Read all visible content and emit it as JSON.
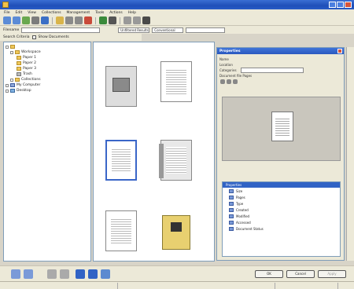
{
  "titlebar": {
    "title": ""
  },
  "menu": [
    "File",
    "Edit",
    "View",
    "Collections",
    "Management",
    "Tools",
    "Actions",
    "Help"
  ],
  "toolbar2": {
    "field_label": "Filename",
    "combo1": "Unfiltered Results",
    "combo2": "Conventional"
  },
  "toolbar3": {
    "search_label": "Search Criteria",
    "checkbox_label": "Show Documents"
  },
  "tree": [
    {
      "label": "",
      "level": 0
    },
    {
      "label": "Workspace",
      "level": 1
    },
    {
      "label": "Paper 1",
      "level": 2
    },
    {
      "label": "Paper 2",
      "level": 2
    },
    {
      "label": "Paper 3",
      "level": 2
    },
    {
      "label": "Trash",
      "level": 2
    },
    {
      "label": "Collections",
      "level": 1
    },
    {
      "label": "My Computer",
      "level": 0
    },
    {
      "label": "Desktop",
      "level": 0
    }
  ],
  "thumbnails": [
    {
      "caption": "",
      "selected": false,
      "kind": "photo"
    },
    {
      "caption": "",
      "selected": false,
      "kind": "doc"
    },
    {
      "caption": "",
      "selected": true,
      "kind": "doc"
    },
    {
      "caption": "",
      "selected": false,
      "kind": "stack"
    },
    {
      "caption": "",
      "selected": false,
      "kind": "doc"
    },
    {
      "caption": "",
      "selected": false,
      "kind": "book"
    }
  ],
  "properties": {
    "title": "Properties",
    "rows": [
      {
        "label": "Name",
        "value": ""
      },
      {
        "label": "Location",
        "value": ""
      },
      {
        "label": "Categories",
        "value": ""
      },
      {
        "label": "Document file Pages",
        "value": ""
      }
    ],
    "table_header": "Properties",
    "table_rows": [
      {
        "key": "Size",
        "value": ""
      },
      {
        "key": "Pages",
        "value": ""
      },
      {
        "key": "Type",
        "value": ""
      },
      {
        "key": "Created",
        "value": ""
      },
      {
        "key": "Modified",
        "value": ""
      },
      {
        "key": "Accessed",
        "value": ""
      },
      {
        "key": "Document Status",
        "value": ""
      }
    ]
  },
  "dialog_buttons": {
    "ok": "OK",
    "cancel": "Cancel",
    "apply": "Apply"
  },
  "status": {
    "left": "",
    "middle": "",
    "right": ""
  },
  "colors": {
    "title_blue": "#2a5cc6",
    "selection_blue": "#3163c5",
    "chrome": "#ece9d8"
  }
}
